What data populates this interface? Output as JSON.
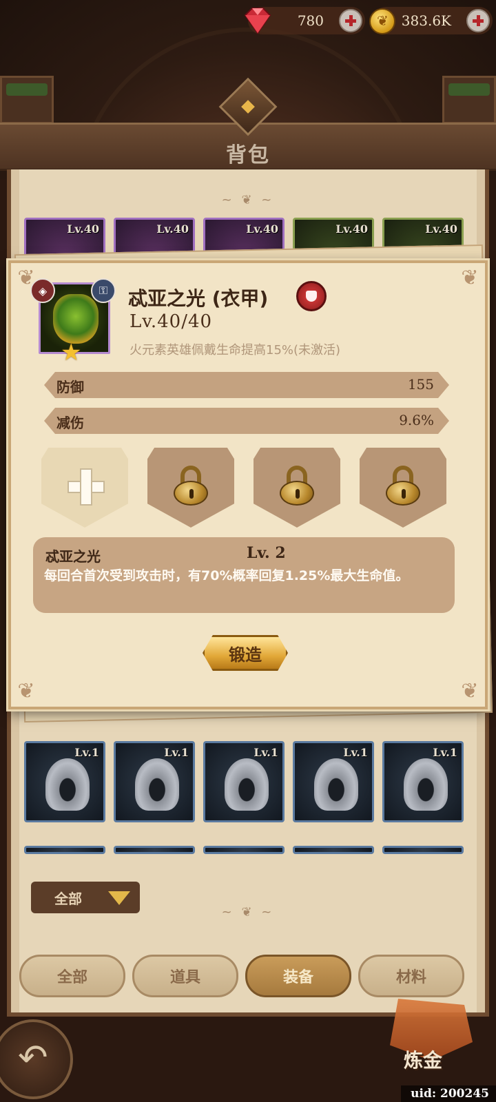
{
  "currency": {
    "gems": "780",
    "gold": "383.6K"
  },
  "page": {
    "title": "背包"
  },
  "inventory": {
    "top_row": [
      {
        "level": "Lv.40",
        "rarity": "purple"
      },
      {
        "level": "Lv.40",
        "rarity": "purple"
      },
      {
        "level": "Lv.40",
        "rarity": "purple"
      },
      {
        "level": "Lv.40",
        "rarity": "green"
      },
      {
        "level": "Lv.40",
        "rarity": "green"
      }
    ],
    "bottom_row": [
      {
        "level": "Lv.1"
      },
      {
        "level": "Lv.1"
      },
      {
        "level": "Lv.1"
      },
      {
        "level": "Lv.1"
      },
      {
        "level": "Lv.1"
      }
    ],
    "filter_label": "全部"
  },
  "tabs": [
    {
      "label": "全部",
      "active": false
    },
    {
      "label": "道具",
      "active": false
    },
    {
      "label": "装备",
      "active": true
    },
    {
      "label": "材料",
      "active": false
    }
  ],
  "alchemy_label": "炼金",
  "uid": "uid: 200245",
  "detail": {
    "name": "忒亚之光 (衣甲)",
    "level": "Lv.40/40",
    "bonus": "火元素英雄佩戴生命提高15%(未激活)",
    "stats": [
      {
        "label": "防御",
        "value": "155"
      },
      {
        "label": "减伤",
        "value": "9.6%"
      }
    ],
    "sockets": [
      "open",
      "locked",
      "locked",
      "locked"
    ],
    "skill": {
      "name": "忒亚之光",
      "level": "Lv. 2",
      "description": "每回合首次受到攻击时，有70%概率回复1.25%最大生命值。"
    },
    "forge_label": "锻造"
  }
}
